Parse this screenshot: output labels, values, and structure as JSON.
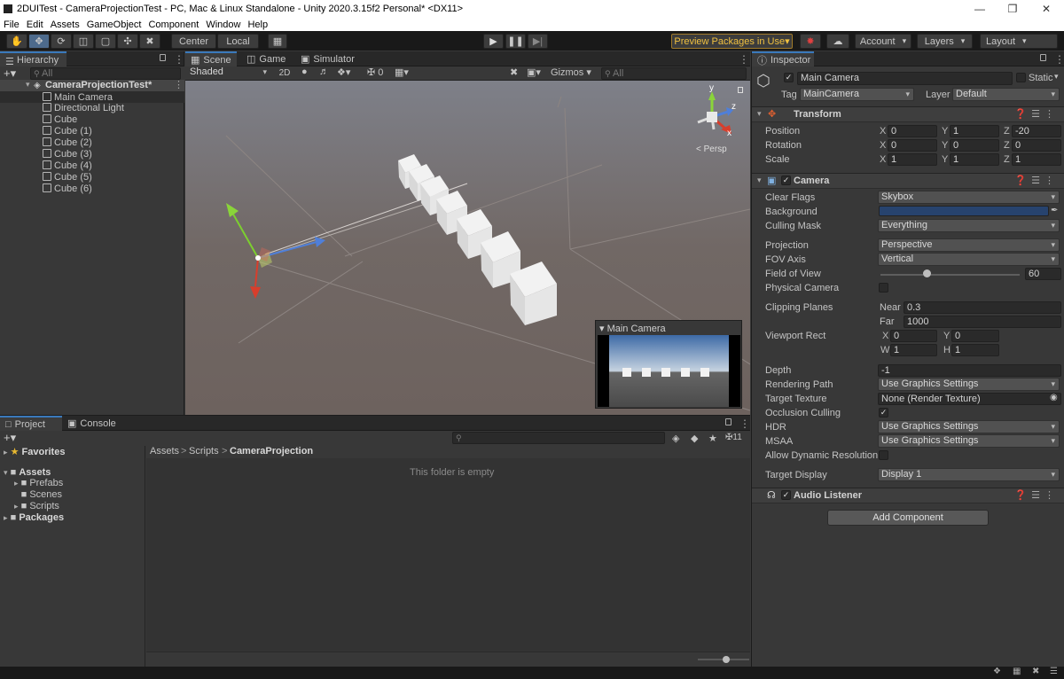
{
  "window": {
    "title": "2DUITest - CameraProjectionTest - PC, Mac & Linux Standalone - Unity 2020.3.15f2 Personal* <DX11>",
    "minimize_icon": "minimize-icon",
    "maximize_icon": "maximize-icon",
    "close_icon": "close-icon"
  },
  "menu": [
    "File",
    "Edit",
    "Assets",
    "GameObject",
    "Component",
    "Window",
    "Help"
  ],
  "toolbar": {
    "tools": [
      "hand-tool-icon",
      "move-tool-icon",
      "rotate-tool-icon",
      "scale-tool-icon",
      "rect-tool-icon",
      "transform-tool-icon",
      "custom-tool-icon"
    ],
    "pivot_mode": "Center",
    "pivot_rotation": "Local",
    "grid_snap_icon": "grid-snap-icon",
    "play_icon": "play-icon",
    "pause_icon": "pause-icon",
    "step_icon": "step-icon",
    "preview_packages": "Preview Packages in Use",
    "account": "Account",
    "layers": "Layers",
    "layout": "Layout"
  },
  "hierarchy": {
    "tab": "Hierarchy",
    "search_placeholder": "All",
    "scene_name": "CameraProjectionTest*",
    "items": [
      "Main Camera",
      "Directional Light",
      "Cube",
      "Cube (1)",
      "Cube (2)",
      "Cube (3)",
      "Cube (4)",
      "Cube (5)",
      "Cube (6)"
    ]
  },
  "scene_view": {
    "tabs": [
      "Scene",
      "Game",
      "Simulator"
    ],
    "shading_mode": "Shaded",
    "mode_2d": "2D",
    "hidden_count": "0",
    "gizmos": "Gizmos",
    "search_placeholder": "All",
    "persp_label": "< Persp",
    "axis_y": "y",
    "axis_z": "z",
    "axis_x": "x",
    "camera_preview_title": "Main Camera"
  },
  "project": {
    "tabs": [
      "Project",
      "Console"
    ],
    "search_placeholder": "",
    "hidden_packages_count": "11",
    "favorites": "Favorites",
    "assets": "Assets",
    "asset_folders": [
      "Prefabs",
      "Scenes",
      "Scripts"
    ],
    "packages": "Packages",
    "breadcrumb": [
      "Assets",
      "Scripts",
      "CameraProjection"
    ],
    "empty_message": "This folder is empty",
    "zoom_slider_value": 0.55
  },
  "inspector": {
    "tab": "Inspector",
    "object_name": "Main Camera",
    "static_label": "Static",
    "tag_label": "Tag",
    "tag_value": "MainCamera",
    "layer_label": "Layer",
    "layer_value": "Default",
    "transform": {
      "title": "Transform",
      "rows": [
        {
          "label": "Position",
          "x": "0",
          "y": "1",
          "z": "-20"
        },
        {
          "label": "Rotation",
          "x": "0",
          "y": "0",
          "z": "0"
        },
        {
          "label": "Scale",
          "x": "1",
          "y": "1",
          "z": "1"
        }
      ]
    },
    "camera": {
      "title": "Camera",
      "clear_flags_label": "Clear Flags",
      "clear_flags": "Skybox",
      "background_label": "Background",
      "background_color": "#27436e",
      "culling_mask_label": "Culling Mask",
      "culling_mask": "Everything",
      "projection_label": "Projection",
      "projection": "Perspective",
      "fov_axis_label": "FOV Axis",
      "fov_axis": "Vertical",
      "fov_label": "Field of View",
      "fov": "60",
      "fov_slider_fraction": 0.33,
      "physical_camera_label": "Physical Camera",
      "clipping_label": "Clipping Planes",
      "near_label": "Near",
      "near": "0.3",
      "far_label": "Far",
      "far": "1000",
      "viewport_label": "Viewport Rect",
      "vp_x": "0",
      "vp_y": "0",
      "vp_w": "1",
      "vp_h": "1",
      "depth_label": "Depth",
      "depth": "-1",
      "rendering_path_label": "Rendering Path",
      "rendering_path": "Use Graphics Settings",
      "target_texture_label": "Target Texture",
      "target_texture": "None (Render Texture)",
      "occlusion_label": "Occlusion Culling",
      "hdr_label": "HDR",
      "hdr": "Use Graphics Settings",
      "msaa_label": "MSAA",
      "msaa": "Use Graphics Settings",
      "dynres_label": "Allow Dynamic Resolution",
      "target_display_label": "Target Display",
      "target_display": "Display 1"
    },
    "audio_listener": {
      "title": "Audio Listener"
    },
    "add_component": "Add Component"
  }
}
